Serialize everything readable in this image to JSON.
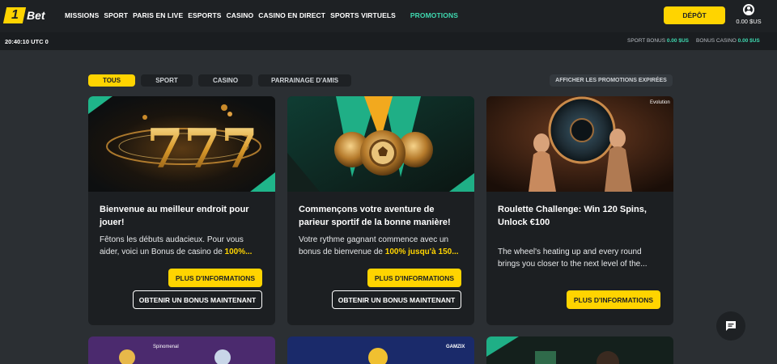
{
  "brand": {
    "logo_number": "1",
    "logo_text": "Bet"
  },
  "nav": {
    "items": [
      "MISSIONS",
      "SPORT",
      "PARIS EN LIVE",
      "ESPORTS",
      "CASINO",
      "CASINO EN DIRECT",
      "SPORTS VIRTUELS"
    ],
    "promotions": "PROMOTIONS"
  },
  "header": {
    "deposit_label": "DÉPÔT",
    "balance": "0.00 $US"
  },
  "subbar": {
    "clock": "20:40:10 UTC 0",
    "sport_bonus_label": "SPORT BONUS",
    "sport_bonus_value": "0.00 $US",
    "casino_bonus_label": "BONUS CASINO",
    "casino_bonus_value": "0.00 $US"
  },
  "filters": {
    "tabs": [
      "TOUS",
      "SPORT",
      "CASINO",
      "PARRAINAGE D'AMIS"
    ],
    "active": "TOUS",
    "expired_label": "AFFICHER LES PROMOTIONS EXPIRÉES"
  },
  "cards": [
    {
      "title": "Bienvenue au meilleur endroit pour jouer!",
      "desc_text": "Fêtons les débuts audacieux. Pour vous aider, voici un Bonus de casino de ",
      "desc_highlight": "100%...",
      "info_label": "PLUS D'INFORMATIONS",
      "bonus_label": "OBTENIR UN BONUS MAINTENANT"
    },
    {
      "title": "Commençons votre aventure de parieur sportif de la bonne manière!",
      "desc_text": " Votre rythme gagnant commence avec un bonus de bienvenue de ",
      "desc_highlight": "100% jusqu'à 150...",
      "info_label": "PLUS D'INFORMATIONS",
      "bonus_label": "OBTENIR UN BONUS MAINTENANT"
    },
    {
      "title": "Roulette Challenge: Win 120 Spins, Unlock €100",
      "desc_text": "The wheel's heating up and every round brings you closer to the next level of the...",
      "info_label": "PLUS D'INFORMATIONS",
      "provider": "Evolution"
    }
  ],
  "lower_cards": {
    "provider_a": "Spinomenal",
    "provider_b": "GAMZIX"
  },
  "icons": [
    "user-icon",
    "chat-icon"
  ],
  "colors": {
    "accent": "#ffd400",
    "promo": "#3fd9b0",
    "background": "#2b2f33",
    "card": "#1c1f22"
  }
}
